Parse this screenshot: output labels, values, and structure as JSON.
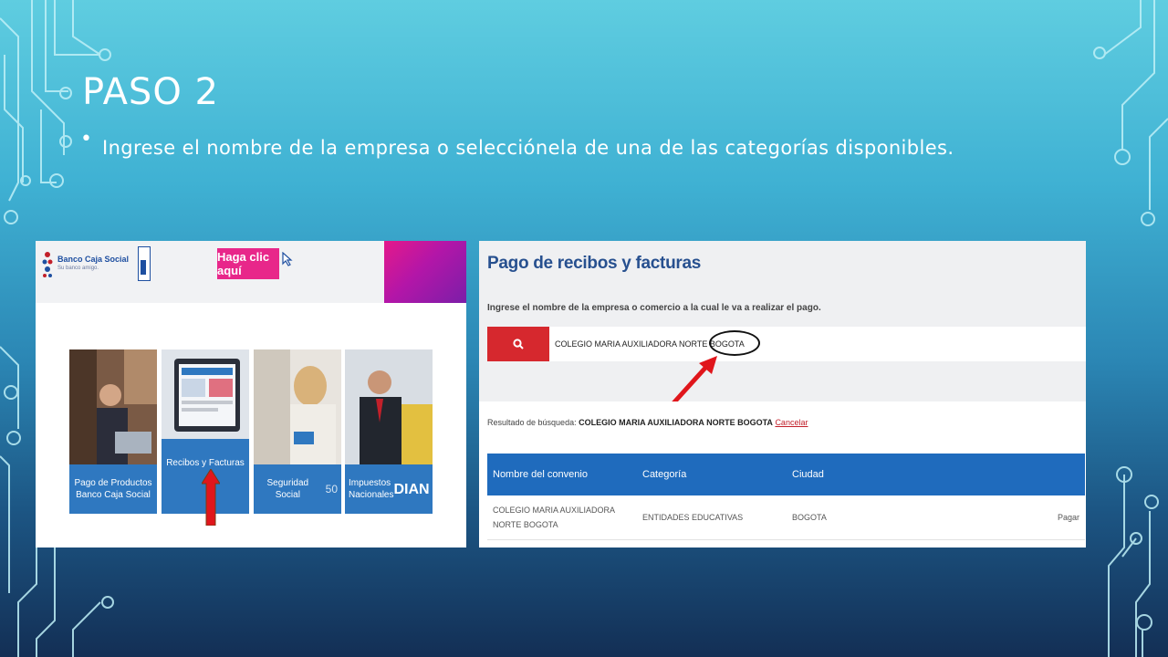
{
  "slide": {
    "title": "PASO 2",
    "bullet": "•",
    "body": "Ingrese el nombre de la empresa o selecciónela de una de las categorías disponibles."
  },
  "left_screenshot": {
    "bank_name": "Banco Caja Social",
    "bank_tagline": "Su banco amigo.",
    "banner_text": "Haga clic aquí",
    "tiles": [
      {
        "label": "Pago de Productos Banco Caja Social"
      },
      {
        "label": "Recibos y Facturas"
      },
      {
        "label": "Seguridad Social"
      },
      {
        "label": "Impuestos Nacionales"
      }
    ],
    "pila_badge": "50",
    "dian_text": "DIAN"
  },
  "right_screenshot": {
    "title": "Pago de recibos y facturas",
    "instruction": "Ingrese el nombre de la empresa o comercio a la cual le va a realizar el pago.",
    "search_value": "COLEGIO MARIA AUXILIADORA NORTE BOGOTA",
    "result_prefix": "Resultado de búsqueda:",
    "result_query": "COLEGIO MARIA AUXILIADORA NORTE BOGOTA",
    "cancel_label": "Cancelar",
    "table": {
      "headers": [
        "Nombre del convenio",
        "Categoría",
        "Ciudad",
        ""
      ],
      "rows": [
        {
          "nombre": "COLEGIO MARIA AUXILIADORA NORTE BOGOTA",
          "categoria": "ENTIDADES EDUCATIVAS",
          "ciudad": "BOGOTA",
          "accion": "Pagar"
        }
      ]
    }
  },
  "colors": {
    "accent_red": "#d6282e",
    "table_header_blue": "#1f6bbd",
    "title_blue": "#27508f"
  }
}
